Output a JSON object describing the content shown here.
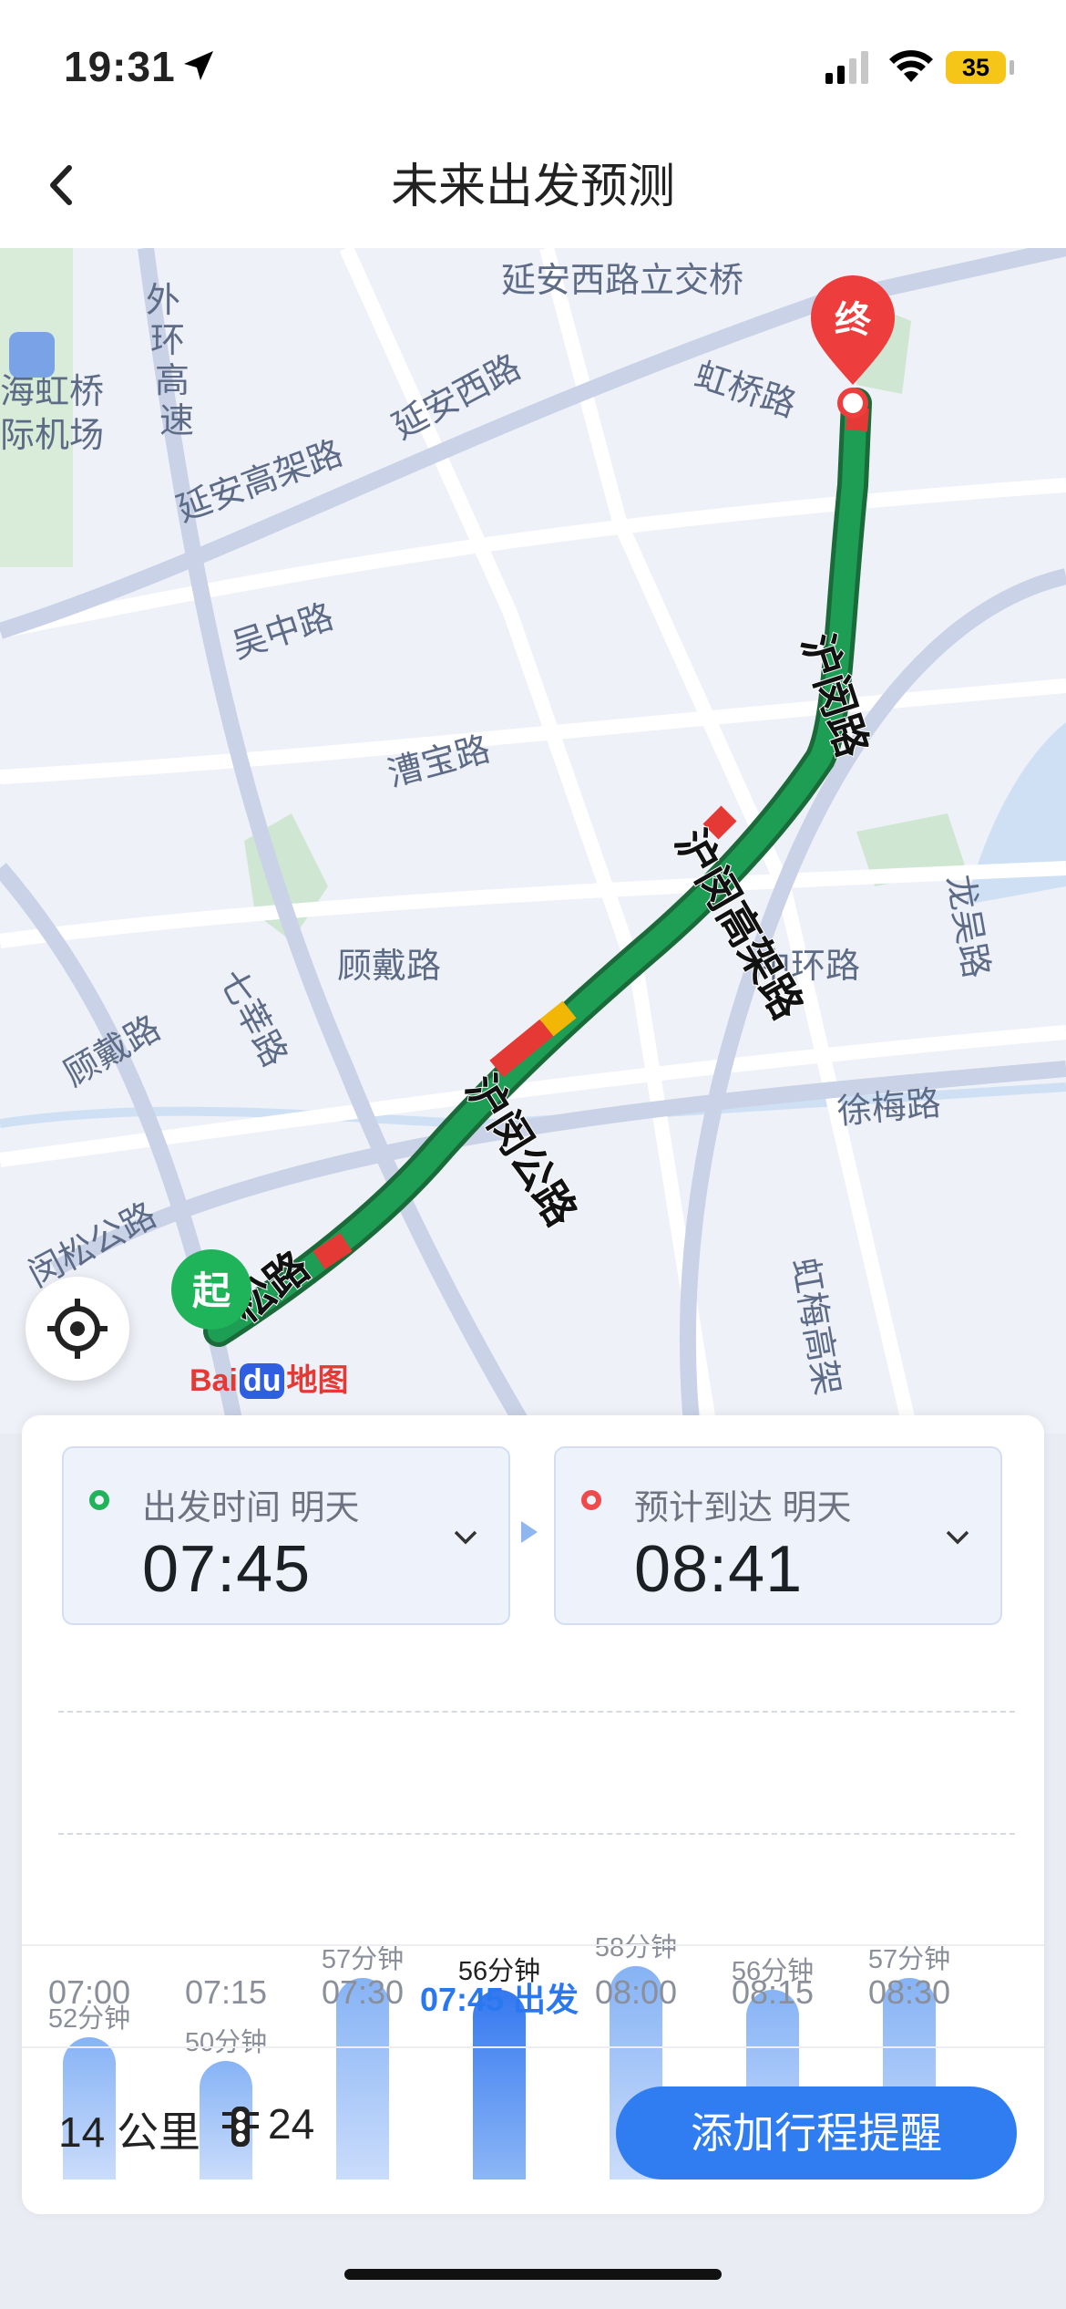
{
  "status": {
    "time": "19:31",
    "battery": "35"
  },
  "nav": {
    "title": "未来出发预测"
  },
  "map": {
    "labels": {
      "yanan_interchange": "延安西路立交桥",
      "yanan_xilu": "延安西路",
      "yanan_elevated": "延安高架路",
      "outer_ring_1": "外",
      "outer_ring_2": "环",
      "outer_ring_3": "高",
      "outer_ring_4": "速",
      "hongqiao": "虹桥路",
      "airport_1": "海虹桥",
      "airport_2": "际机场",
      "wuzhong": "吴中路",
      "caobao": "漕宝路",
      "gudai": "顾戴路",
      "gudai2": "顾戴路",
      "qixin": "七莘路",
      "humin_1": "沪闵路",
      "humin_elevated": "沪闵高架路",
      "humin_road": "沪闵公路",
      "zhonghuan": "中环路",
      "longwu": "龙吴路",
      "xumei": "徐梅路",
      "hongmei": "虹梅高架",
      "minsong": "闵松公路",
      "songlu": "松路",
      "start_marker": "起",
      "end_marker": "终"
    },
    "logo": {
      "bai": "Bai",
      "du": "du",
      "map": "地图"
    }
  },
  "panel": {
    "depart": {
      "label": "出发时间 明天",
      "time": "07:45"
    },
    "arrive": {
      "label": "预计到达 明天",
      "time": "08:41"
    },
    "summary": {
      "distance": "14 公里",
      "lights": "24"
    },
    "cta": "添加行程提醒"
  },
  "chart_data": {
    "type": "bar",
    "categories": [
      "07:00",
      "07:15",
      "07:30",
      "07:45 出发",
      "08:00",
      "08:15",
      "08:30"
    ],
    "values": [
      52,
      50,
      57,
      56,
      58,
      56,
      57
    ],
    "value_labels": [
      "52分钟",
      "50分钟",
      "57分钟",
      "56分钟",
      "58分钟",
      "56分钟",
      "57分钟"
    ],
    "selected_index": 3,
    "unit": "分钟",
    "ylim": [
      0,
      60
    ],
    "colors": {
      "bar": "#86b3f5",
      "selected": "#3478f0",
      "selected_label": "#2a78f0"
    }
  },
  "colors": {
    "accent": "#2f7df1",
    "route_green": "#1e9e55",
    "route_red": "#e53935",
    "route_yellow": "#f2b705"
  }
}
